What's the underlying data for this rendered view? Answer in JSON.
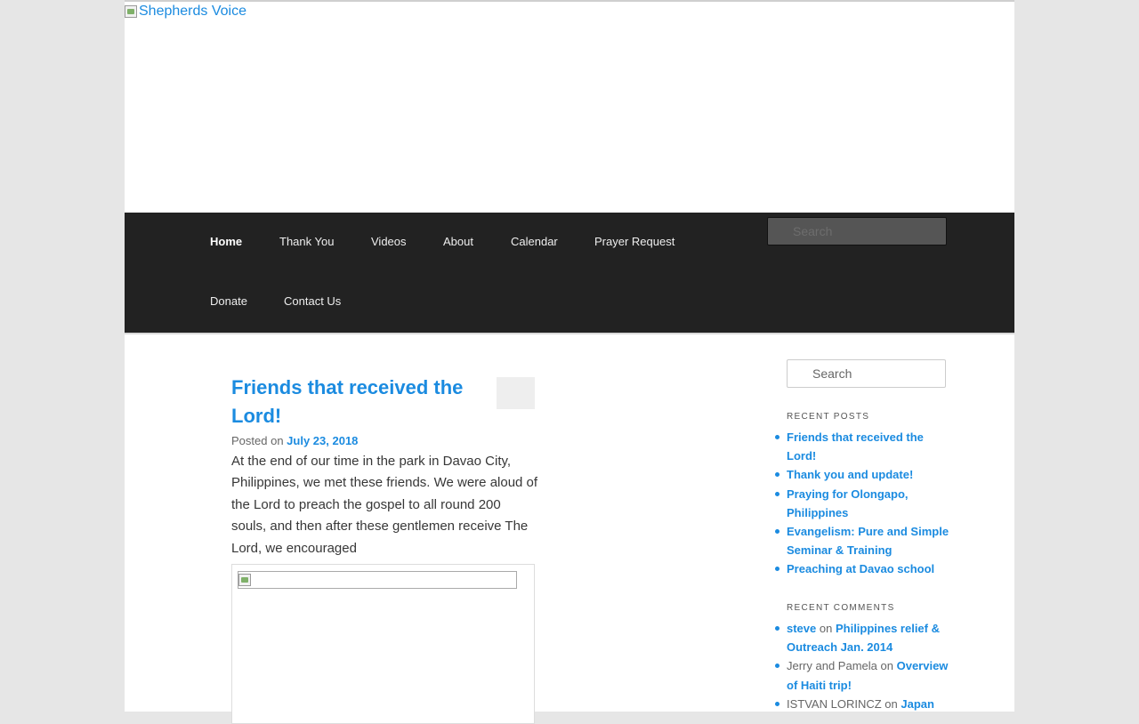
{
  "site": {
    "logo_alt": "Shepherds Voice"
  },
  "nav": {
    "items": [
      {
        "label": "Home",
        "active": true
      },
      {
        "label": "Thank You"
      },
      {
        "label": "Videos"
      },
      {
        "label": "About"
      },
      {
        "label": "Calendar"
      },
      {
        "label": "Prayer Request"
      },
      {
        "label": "Donate"
      },
      {
        "label": "Contact Us"
      }
    ],
    "search_placeholder": "Search"
  },
  "post": {
    "title": "Friends that received the Lord!",
    "posted_on_label": "Posted on",
    "date": "July 23, 2018",
    "excerpt": "At the end of our time in the park in Davao City, Philippines, we met these friends. We were aloud of the Lord to preach the gospel to all round 200 souls, and then after these gentlemen receive The Lord, we encouraged"
  },
  "sidebar": {
    "search_placeholder": "Search",
    "recent_posts_title": "RECENT POSTS",
    "recent_posts": [
      "Friends that received the Lord!",
      "Thank you and update!",
      "Praying for Olongapo, Philippines",
      "Evangelism: Pure and Simple Seminar & Training",
      "Preaching at Davao school"
    ],
    "recent_comments_title": "RECENT COMMENTS",
    "recent_comments": [
      {
        "author": "steve",
        "author_link": true,
        "on": "on",
        "post": "Philippines relief & Outreach Jan. 2014"
      },
      {
        "author": "Jerry and Pamela",
        "author_link": false,
        "on": "on",
        "post": "Overview of Haiti trip!"
      },
      {
        "author": "ISTVAN LORINCZ",
        "author_link": false,
        "on": "on",
        "post": "Japan"
      }
    ]
  },
  "colors": {
    "link": "#1b8be0",
    "nav_bg": "#222222",
    "page_bg": "#e6e6e6"
  }
}
